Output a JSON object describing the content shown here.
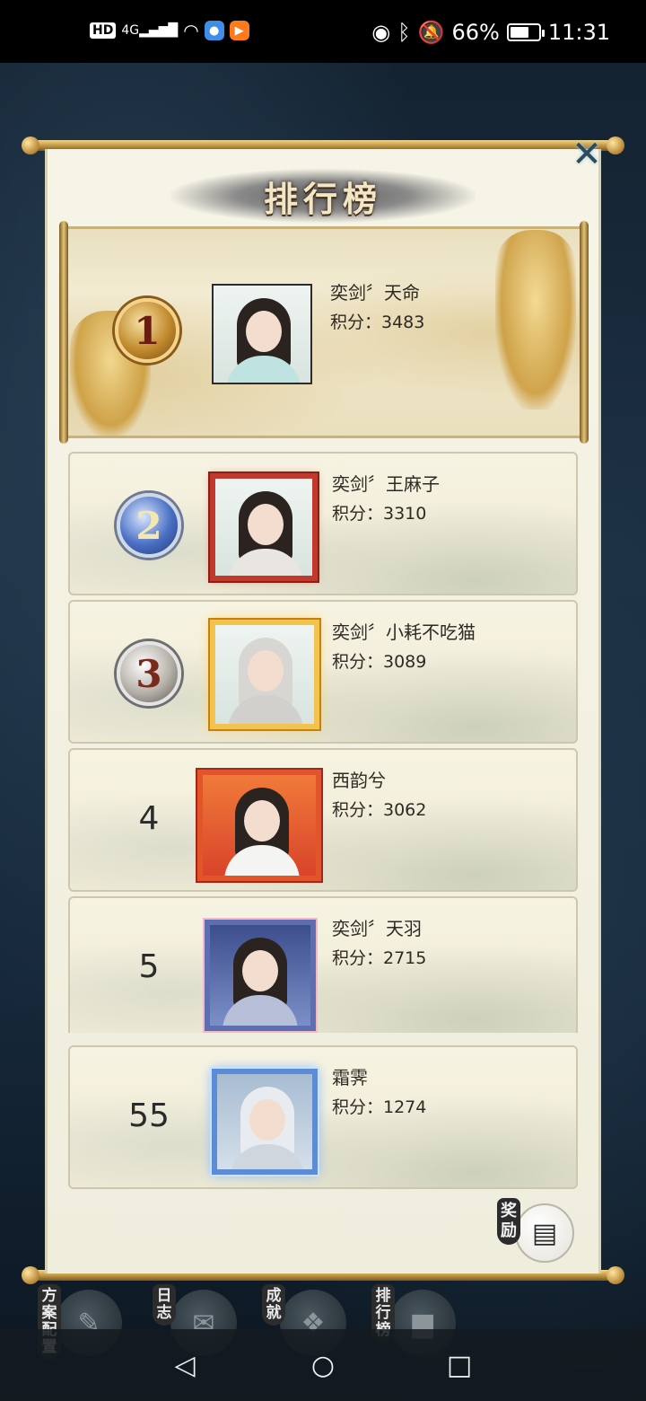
{
  "status_bar": {
    "hd_badge": "HD",
    "network": "4G",
    "battery_percent": "66%",
    "battery_level": 0.66,
    "time": "11:31"
  },
  "panel": {
    "title": "排行榜",
    "close_label": "✕"
  },
  "rankings": [
    {
      "rank": "1",
      "name": "奕剑〞天命",
      "score": "积分：3483",
      "frame": "plain"
    },
    {
      "rank": "2",
      "name": "奕剑〞王麻子",
      "score": "积分：3310",
      "frame": "red"
    },
    {
      "rank": "3",
      "name": "奕剑〞小耗不吃猫",
      "score": "积分：3089",
      "frame": "gold"
    },
    {
      "rank": "4",
      "name": "西韵兮",
      "score": "积分：3062",
      "frame": "fire"
    },
    {
      "rank": "5",
      "name": "奕剑〞天羽",
      "score": "积分：2715",
      "frame": "blossom"
    }
  ],
  "self_entry": {
    "rank": "55",
    "name": "霜霁",
    "score": "积分：1274",
    "frame": "ice"
  },
  "reward": {
    "label": "奖励"
  },
  "game_nav": [
    {
      "label": "方案配置",
      "icon": "scroll-icon"
    },
    {
      "label": "日志",
      "icon": "note-icon"
    },
    {
      "label": "成就",
      "icon": "achievement-icon"
    },
    {
      "label": "排行榜",
      "icon": "ranking-icon"
    }
  ],
  "colors": {
    "panel_bg": "#f6f4e6",
    "gold_accent": "#c59a3a",
    "text": "#2d2a24"
  }
}
